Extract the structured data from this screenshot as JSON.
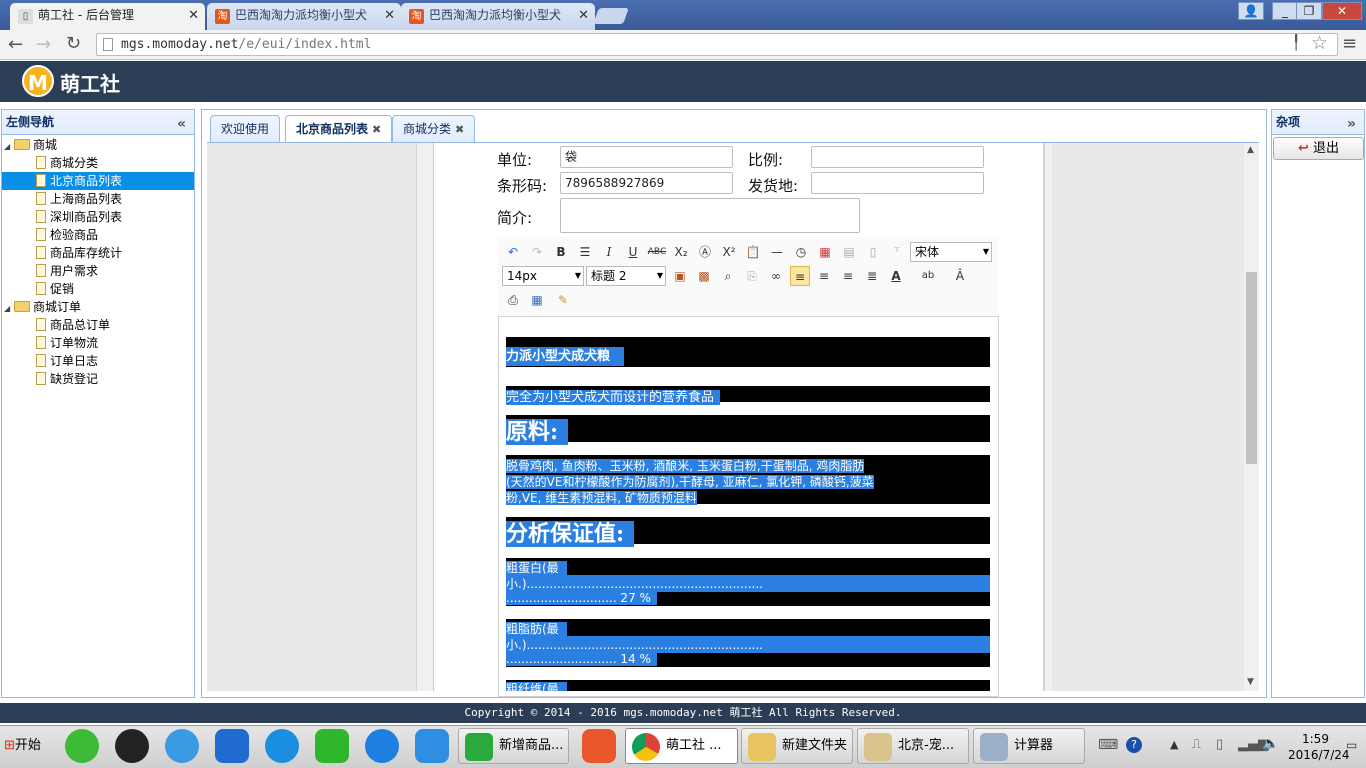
{
  "browser": {
    "tabs": [
      {
        "label": "萌工社 - 后台管理",
        "active": true
      },
      {
        "label": "巴西淘淘力派均衡小型犬",
        "active": false
      },
      {
        "label": "巴西淘淘力派均衡小型犬",
        "active": false
      }
    ],
    "url_host": "mgs.momoday.net",
    "url_path": "/e/eui/index.html"
  },
  "app": {
    "brand": "萌工社",
    "logo_letter": "M"
  },
  "left_nav": {
    "title": "左侧导航",
    "collapse_glyph": "«",
    "groups": [
      {
        "label": "商城",
        "items": [
          "商城分类",
          "北京商品列表",
          "上海商品列表",
          "深圳商品列表",
          "检验商品",
          "商品库存统计",
          "用户需求",
          "促销"
        ]
      },
      {
        "label": "商城订单",
        "items": [
          "商品总订单",
          "订单物流",
          "订单日志",
          "缺货登记"
        ]
      }
    ],
    "selected": "北京商品列表"
  },
  "page_tabs": [
    {
      "label": "欢迎使用",
      "closable": false,
      "active": false
    },
    {
      "label": "北京商品列表",
      "closable": true,
      "active": true
    },
    {
      "label": "商城分类",
      "closable": true,
      "active": false
    }
  ],
  "form": {
    "unit_label": "单位:",
    "unit_value": "袋",
    "ratio_label": "比例:",
    "ratio_value": "",
    "barcode_label": "条形码:",
    "barcode_value": "7896588927869",
    "origin_label": "发货地:",
    "origin_value": "",
    "intro_label": "简介:",
    "intro_value": ""
  },
  "editor": {
    "font_family": "宋体",
    "font_size": "14px",
    "heading": "标题 2",
    "content": {
      "title": "力派小型犬成犬粮",
      "subtitle": "完全为小型犬成犬而设计的营养食品",
      "ingredients_heading": "原料:",
      "ingredients_lines": [
        "脱骨鸡肉, 鱼肉粉、玉米粉,     酒酿米,   玉米蛋白粉,干蛋制品, 鸡肉脂肪",
        "(天然的VE和柠檬酸作为防腐剂),干酵母, 亚麻仁, 氯化钾, 磷酸钙,菠菜",
        "粉,VE, 维生素预混料, 矿物质预混料"
      ],
      "analysis_heading": "分析保证值:",
      "protein_line1": "粗蛋白(最",
      "protein_line2": "小.)..............................................................",
      "protein_line3": "............................. 27 %",
      "fat_line1": "粗脂肪(最",
      "fat_line2": "小.)..............................................................",
      "fat_line3": "............................. 14 %",
      "fiber_line1": "粗纤维(最"
    }
  },
  "right_panel": {
    "title": "杂项",
    "collapse_glyph": "»",
    "exit_label": "退出"
  },
  "footer": {
    "text": "Copyright © 2014 - 2016 mgs.momoday.net 萌工社 All Rights Reserved."
  },
  "taskbar": {
    "start_label": "开始",
    "buttons": [
      {
        "label": "新增商品..."
      },
      {
        "label": "萌工社 ..."
      },
      {
        "label": "新建文件夹"
      },
      {
        "label": "北京-宠..."
      },
      {
        "label": "计算器"
      }
    ],
    "time": "1:59",
    "date": "2016/7/24"
  }
}
